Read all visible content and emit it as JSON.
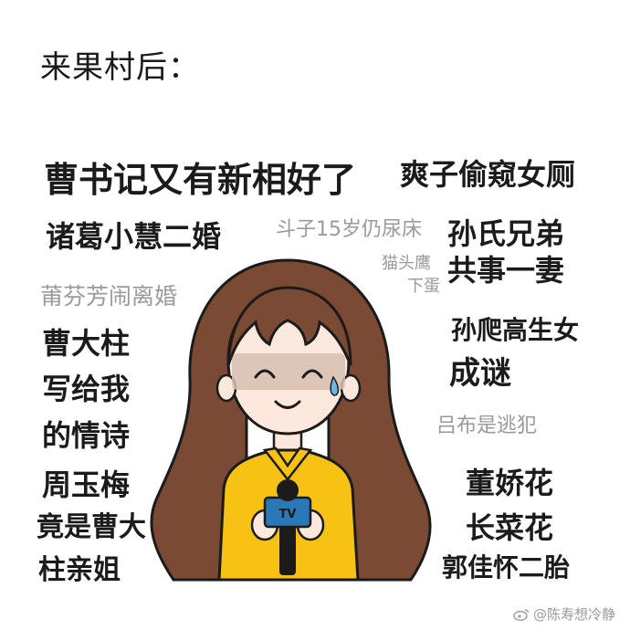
{
  "title": "来果村后：",
  "notes": {
    "cao_new_love": "曹书记又有新相好了",
    "shuangzi": "爽子偷窥女厕",
    "zhuge": "诸葛小慧二婚",
    "douzi": "斗子15岁仍尿床",
    "maotou_1": "猫头鹰",
    "maotou_2": "下蛋",
    "sun_1": "孙氏兄弟",
    "sun_2": "共事一妻",
    "puxiang": "莆芬芳闹离婚",
    "cao_poem_1": "曹大柱",
    "cao_poem_2": "写给我",
    "cao_poem_3": "的情诗",
    "sunpa_1": "孙爬高生女",
    "sunpa_2": "成谜",
    "lvbu": "吕布是逃犯",
    "zhou_1": "周玉梅",
    "zhou_2": "竟是曹大",
    "zhou_3": "柱亲姐",
    "dong_1": "董娇花",
    "dong_2": "长菜花",
    "guo": "郭佳怀二胎"
  },
  "illustration": {
    "mic_text": "TV"
  },
  "watermark": {
    "icon": "weibo-icon",
    "text": "@陈寿想冷静"
  },
  "colors": {
    "hair": "#7a4a34",
    "hair_outline": "#1b1b1b",
    "skin": "#fde8dd",
    "shirt": "#f7c213",
    "mic_body": "#2a78b8",
    "text_dark": "#1b1b1b",
    "text_grey": "#9a9a9a"
  }
}
